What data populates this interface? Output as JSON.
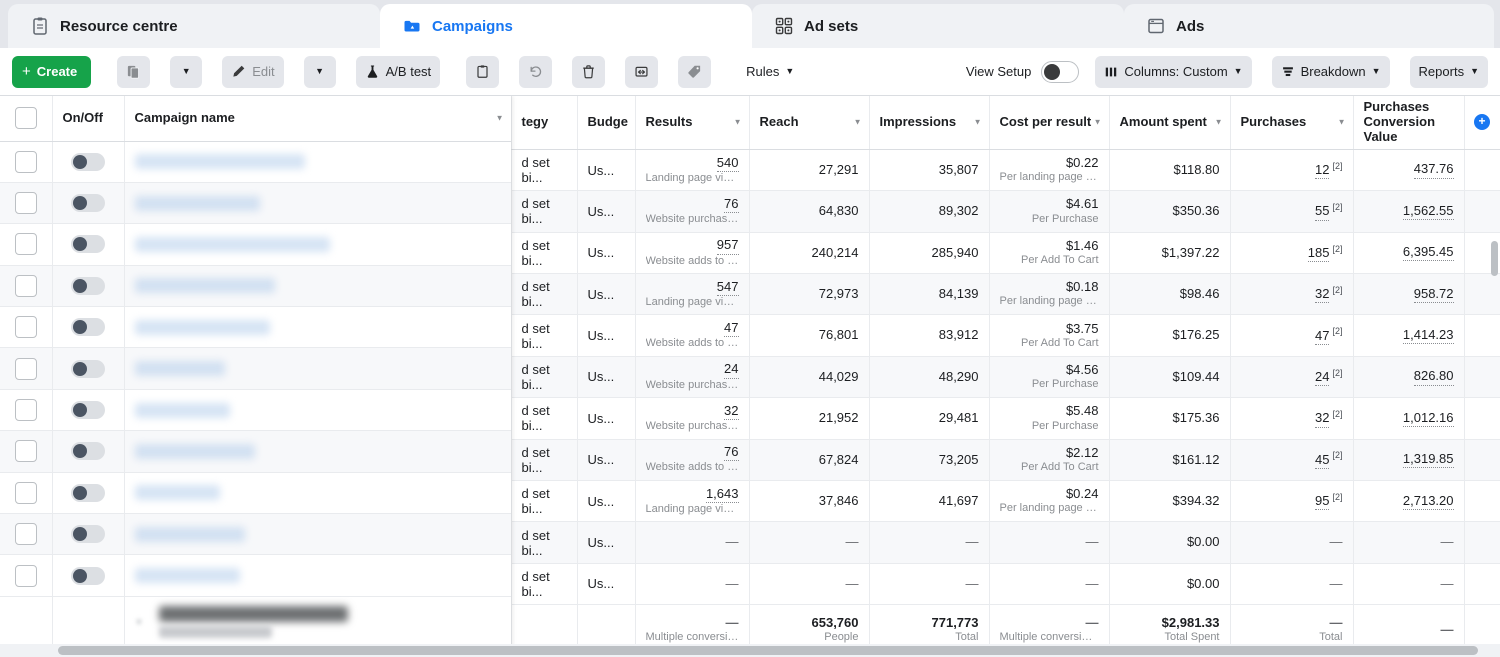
{
  "tabs": [
    {
      "label": "Resource centre",
      "icon": "clipboard-icon",
      "active": false
    },
    {
      "label": "Campaigns",
      "icon": "campaign-icon",
      "active": true
    },
    {
      "label": "Ad sets",
      "icon": "adsets-icon",
      "active": false
    },
    {
      "label": "Ads",
      "icon": "ads-icon",
      "active": false
    }
  ],
  "toolbar": {
    "create_label": "Create",
    "create_plus": "+",
    "duplicate_icon": "duplicate-icon",
    "duplicate_caret": "▼",
    "edit_label": "Edit",
    "edit_icon": "pencil-icon",
    "edit_caret": "▼",
    "abtest_label": "A/B test",
    "abtest_icon": "flask-icon",
    "clipboard_icon": "clipboard-outline-icon",
    "undo_icon": "undo-icon",
    "delete_icon": "trash-icon",
    "export_icon": "export-icon",
    "tag_icon": "tag-icon",
    "rules_label": "Rules",
    "rules_caret": "▼",
    "view_setup_label": "View Setup",
    "view_setup_toggle": "view-setup-toggle",
    "columns_label": "Columns: Custom",
    "columns_caret": "▼",
    "breakdown_label": "Breakdown",
    "breakdown_caret": "▼",
    "reports_label": "Reports",
    "reports_caret": "▼"
  },
  "colors": {
    "accent_blue": "#1877f2",
    "create_green": "#16a34a",
    "tabbar_grey": "#e4e6eb"
  },
  "table": {
    "headers": {
      "onoff": "On/Off",
      "campaign_name": "Campaign name",
      "strategy": "tegy",
      "budget": "Budge",
      "results": "Results",
      "reach": "Reach",
      "impressions": "Impressions",
      "cost_per_result": "Cost per result",
      "amount_spent": "Amount spent",
      "purchases": "Purchases",
      "purchases_conversion_value": "Purchases Conversion Value",
      "add_column": "+"
    },
    "rows": [
      {
        "strategy": "d set bi...",
        "budget": "Us...",
        "results": "540",
        "results_sub": "Landing page views",
        "reach": "27,291",
        "impressions": "35,807",
        "cpr": "$0.22",
        "cpr_sub": "Per landing page v...",
        "spent": "$118.80",
        "purchases": "12",
        "purchases_sup": "[2]",
        "pcv": "437.76"
      },
      {
        "strategy": "d set bi...",
        "budget": "Us...",
        "results": "76",
        "results_sub": "Website purchases",
        "reach": "64,830",
        "impressions": "89,302",
        "cpr": "$4.61",
        "cpr_sub": "Per Purchase",
        "spent": "$350.36",
        "purchases": "55",
        "purchases_sup": "[2]",
        "pcv": "1,562.55"
      },
      {
        "strategy": "d set bi...",
        "budget": "Us...",
        "results": "957",
        "results_sub": "Website adds to c...",
        "reach": "240,214",
        "impressions": "285,940",
        "cpr": "$1.46",
        "cpr_sub": "Per Add To Cart",
        "spent": "$1,397.22",
        "purchases": "185",
        "purchases_sup": "[2]",
        "pcv": "6,395.45"
      },
      {
        "strategy": "d set bi...",
        "budget": "Us...",
        "results": "547",
        "results_sub": "Landing page views",
        "reach": "72,973",
        "impressions": "84,139",
        "cpr": "$0.18",
        "cpr_sub": "Per landing page v...",
        "spent": "$98.46",
        "purchases": "32",
        "purchases_sup": "[2]",
        "pcv": "958.72"
      },
      {
        "strategy": "d set bi...",
        "budget": "Us...",
        "results": "47",
        "results_sub": "Website adds to c...",
        "reach": "76,801",
        "impressions": "83,912",
        "cpr": "$3.75",
        "cpr_sub": "Per Add To Cart",
        "spent": "$176.25",
        "purchases": "47",
        "purchases_sup": "[2]",
        "pcv": "1,414.23"
      },
      {
        "strategy": "d set bi...",
        "budget": "Us...",
        "results": "24",
        "results_sub": "Website purchases",
        "reach": "44,029",
        "impressions": "48,290",
        "cpr": "$4.56",
        "cpr_sub": "Per Purchase",
        "spent": "$109.44",
        "purchases": "24",
        "purchases_sup": "[2]",
        "pcv": "826.80"
      },
      {
        "strategy": "d set bi...",
        "budget": "Us...",
        "results": "32",
        "results_sub": "Website purchases",
        "reach": "21,952",
        "impressions": "29,481",
        "cpr": "$5.48",
        "cpr_sub": "Per Purchase",
        "spent": "$175.36",
        "purchases": "32",
        "purchases_sup": "[2]",
        "pcv": "1,012.16"
      },
      {
        "strategy": "d set bi...",
        "budget": "Us...",
        "results": "76",
        "results_sub": "Website adds to c...",
        "reach": "67,824",
        "impressions": "73,205",
        "cpr": "$2.12",
        "cpr_sub": "Per Add To Cart",
        "spent": "$161.12",
        "purchases": "45",
        "purchases_sup": "[2]",
        "pcv": "1,319.85"
      },
      {
        "strategy": "d set bi...",
        "budget": "Us...",
        "results": "1,643",
        "results_sub": "Landing page views",
        "reach": "37,846",
        "impressions": "41,697",
        "cpr": "$0.24",
        "cpr_sub": "Per landing page v...",
        "spent": "$394.32",
        "purchases": "95",
        "purchases_sup": "[2]",
        "pcv": "2,713.20"
      },
      {
        "strategy": "d set bi...",
        "budget": "Us...",
        "results": "—",
        "results_sub": "",
        "reach": "—",
        "impressions": "—",
        "cpr": "—",
        "cpr_sub": "",
        "spent": "$0.00",
        "purchases": "—",
        "purchases_sup": "",
        "pcv": "—"
      },
      {
        "strategy": "d set bi...",
        "budget": "Us...",
        "results": "—",
        "results_sub": "",
        "reach": "—",
        "impressions": "—",
        "cpr": "—",
        "cpr_sub": "",
        "spent": "$0.00",
        "purchases": "—",
        "purchases_sup": "",
        "pcv": "—"
      }
    ],
    "footer": {
      "results": "—",
      "results_sub": "Multiple conversions",
      "reach": "653,760",
      "reach_sub": "People",
      "impressions": "771,773",
      "impressions_sub": "Total",
      "cpr": "—",
      "cpr_sub": "Multiple conversions",
      "spent": "$2,981.33",
      "spent_sub": "Total Spent",
      "purchases": "—",
      "purchases_sub": "Total",
      "pcv": "—",
      "pcv_sub": ""
    }
  }
}
